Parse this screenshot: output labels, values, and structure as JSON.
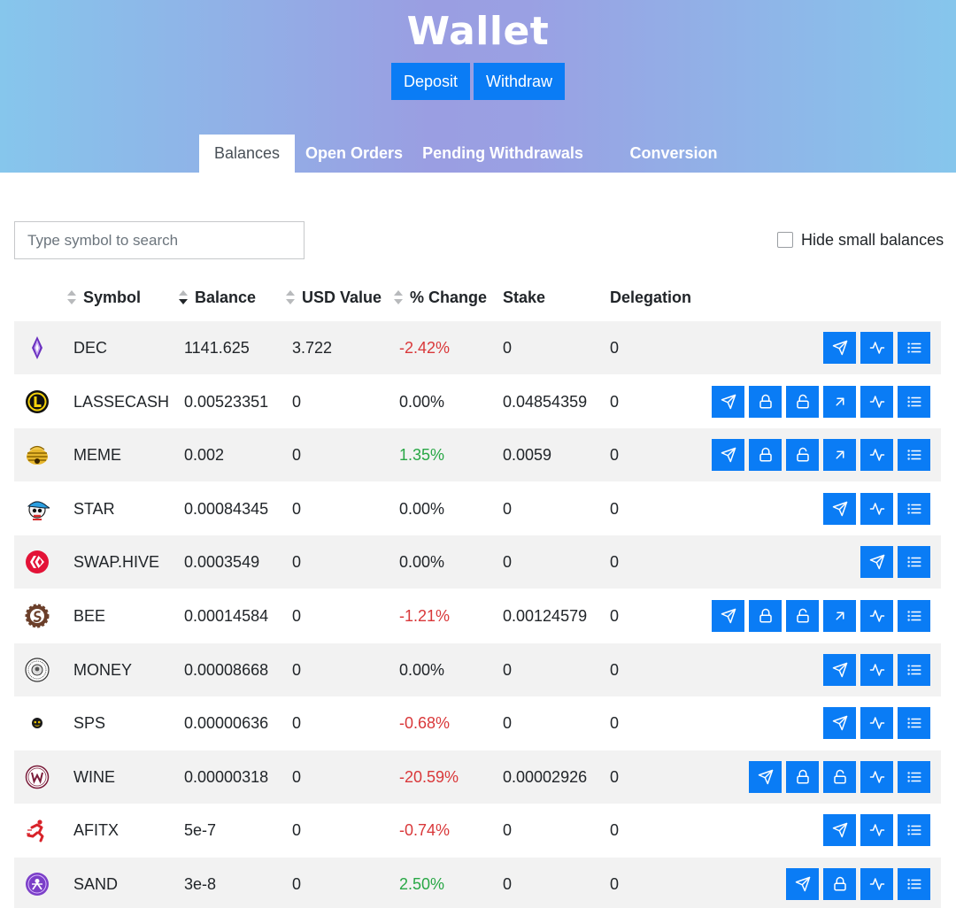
{
  "header": {
    "title": "Wallet",
    "deposit_label": "Deposit",
    "withdraw_label": "Withdraw"
  },
  "tabs": [
    {
      "label": "Balances",
      "active": true
    },
    {
      "label": "Open Orders",
      "active": false
    },
    {
      "label": "Pending Withdrawals",
      "active": false
    },
    {
      "label": "Conversion History",
      "active": false
    }
  ],
  "search": {
    "placeholder": "Type symbol to search",
    "value": ""
  },
  "hide_small": {
    "label": "Hide small balances",
    "checked": false
  },
  "columns": {
    "symbol": "Symbol",
    "balance": "Balance",
    "usd_value": "USD Value",
    "change": "% Change",
    "stake": "Stake",
    "delegation": "Delegation"
  },
  "colors": {
    "accent": "#0a7cf5",
    "negative": "#d9383a",
    "positive": "#28a745"
  },
  "rows": [
    {
      "symbol": "DEC",
      "icon": "dec-gem-icon",
      "balance": "1141.625",
      "usd": "3.722",
      "change": "-2.42%",
      "trend": "neg",
      "stake": "0",
      "delegation": "0",
      "actions": [
        "send",
        "chart",
        "list"
      ]
    },
    {
      "symbol": "LASSECASH",
      "icon": "lassecash-coin-icon",
      "balance": "0.00523351",
      "usd": "0",
      "change": "0.00%",
      "trend": "flat",
      "stake": "0.04854359",
      "delegation": "0",
      "actions": [
        "send",
        "lock",
        "unlock",
        "delegate",
        "chart",
        "list"
      ]
    },
    {
      "symbol": "MEME",
      "icon": "meme-hive-icon",
      "balance": "0.002",
      "usd": "0",
      "change": "1.35%",
      "trend": "pos",
      "stake": "0.0059",
      "delegation": "0",
      "actions": [
        "send",
        "lock",
        "unlock",
        "delegate",
        "chart",
        "list"
      ]
    },
    {
      "symbol": "STAR",
      "icon": "star-character-icon",
      "balance": "0.00084345",
      "usd": "0",
      "change": "0.00%",
      "trend": "flat",
      "stake": "0",
      "delegation": "0",
      "actions": [
        "send",
        "chart",
        "list"
      ]
    },
    {
      "symbol": "SWAP.HIVE",
      "icon": "hive-logo-icon",
      "balance": "0.0003549",
      "usd": "0",
      "change": "0.00%",
      "trend": "flat",
      "stake": "0",
      "delegation": "0",
      "actions": [
        "send",
        "list"
      ]
    },
    {
      "symbol": "BEE",
      "icon": "bee-gear-icon",
      "balance": "0.00014584",
      "usd": "0",
      "change": "-1.21%",
      "trend": "neg",
      "stake": "0.00124579",
      "delegation": "0",
      "actions": [
        "send",
        "lock",
        "unlock",
        "delegate",
        "chart",
        "list"
      ]
    },
    {
      "symbol": "MONEY",
      "icon": "money-seal-icon",
      "balance": "0.00008668",
      "usd": "0",
      "change": "0.00%",
      "trend": "flat",
      "stake": "0",
      "delegation": "0",
      "actions": [
        "send",
        "chart",
        "list"
      ]
    },
    {
      "symbol": "SPS",
      "icon": "sps-face-icon",
      "balance": "0.00000636",
      "usd": "0",
      "change": "-0.68%",
      "trend": "neg",
      "stake": "0",
      "delegation": "0",
      "actions": [
        "send",
        "chart",
        "list"
      ]
    },
    {
      "symbol": "WINE",
      "icon": "wine-w-icon",
      "balance": "0.00000318",
      "usd": "0",
      "change": "-20.59%",
      "trend": "neg",
      "stake": "0.00002926",
      "delegation": "0",
      "actions": [
        "send",
        "lock",
        "unlock",
        "chart",
        "list"
      ]
    },
    {
      "symbol": "AFITX",
      "icon": "afitx-runner-icon",
      "balance": "5e-7",
      "usd": "0",
      "change": "-0.74%",
      "trend": "neg",
      "stake": "0",
      "delegation": "0",
      "actions": [
        "send",
        "chart",
        "list"
      ]
    },
    {
      "symbol": "SAND",
      "icon": "sand-emblem-icon",
      "balance": "3e-8",
      "usd": "0",
      "change": "2.50%",
      "trend": "pos",
      "stake": "0",
      "delegation": "0",
      "actions": [
        "send",
        "lock",
        "chart",
        "list"
      ]
    }
  ]
}
